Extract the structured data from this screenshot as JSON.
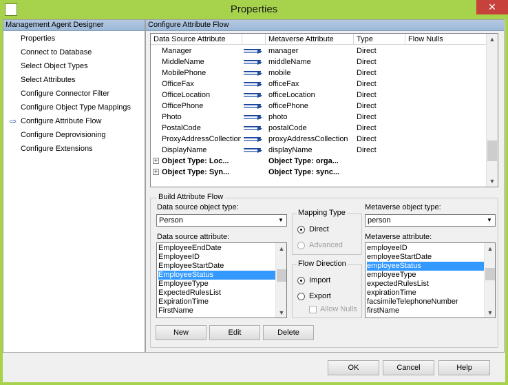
{
  "window": {
    "title": "Properties",
    "close_glyph": "✕"
  },
  "left_pane": {
    "header": "Management Agent Designer",
    "items": [
      {
        "label": "Properties"
      },
      {
        "label": "Connect to Database"
      },
      {
        "label": "Select Object Types"
      },
      {
        "label": "Select Attributes"
      },
      {
        "label": "Configure Connector Filter"
      },
      {
        "label": "Configure Object Type Mappings"
      },
      {
        "label": "Configure Attribute Flow"
      },
      {
        "label": "Configure Deprovisioning"
      },
      {
        "label": "Configure Extensions"
      }
    ],
    "current_index": 6
  },
  "right_pane": {
    "header": "Configure Attribute Flow"
  },
  "flow_grid": {
    "columns": [
      "Data Source Attribute",
      "",
      "Metaverse Attribute",
      "Type",
      "Flow Nulls"
    ],
    "rows": [
      {
        "source": "Manager",
        "metaverse": "manager",
        "type": "Direct"
      },
      {
        "source": "MiddleName",
        "metaverse": "middleName",
        "type": "Direct"
      },
      {
        "source": "MobilePhone",
        "metaverse": "mobile",
        "type": "Direct"
      },
      {
        "source": "OfficeFax",
        "metaverse": "officeFax",
        "type": "Direct"
      },
      {
        "source": "OfficeLocation",
        "metaverse": "officeLocation",
        "type": "Direct"
      },
      {
        "source": "OfficePhone",
        "metaverse": "officePhone",
        "type": "Direct"
      },
      {
        "source": "Photo",
        "metaverse": "photo",
        "type": "Direct"
      },
      {
        "source": "PostalCode",
        "metaverse": "postalCode",
        "type": "Direct"
      },
      {
        "source": "ProxyAddressCollection",
        "metaverse": "proxyAddressCollection",
        "type": "Direct"
      },
      {
        "source": "DisplayName",
        "metaverse": "displayName",
        "type": "Direct"
      }
    ],
    "groups": [
      {
        "source": "Object Type: Loc...",
        "metaverse": "Object Type: orga..."
      },
      {
        "source": "Object Type: Syn...",
        "metaverse": "Object Type: sync..."
      }
    ]
  },
  "build": {
    "label": "Build Attribute Flow",
    "ds_object_type_label": "Data source object type:",
    "ds_object_type_value": "Person",
    "ds_attribute_label": "Data source attribute:",
    "ds_attributes": [
      "EmployeeEndDate",
      "EmployeeID",
      "EmployeeStartDate",
      "EmployeeStatus",
      "EmployeeType",
      "ExpectedRulesList",
      "ExpirationTime",
      "FirstName"
    ],
    "ds_selected": 3,
    "mapping_type_label": "Mapping Type",
    "mapping_direct": "Direct",
    "mapping_advanced": "Advanced",
    "flow_direction_label": "Flow Direction",
    "flow_import": "Import",
    "flow_export": "Export",
    "allow_nulls": "Allow Nulls",
    "mv_object_type_label": "Metaverse object type:",
    "mv_object_type_value": "person",
    "mv_attribute_label": "Metaverse attribute:",
    "mv_attributes": [
      "employeeID",
      "employeeStartDate",
      "employeeStatus",
      "employeeType",
      "expectedRulesList",
      "expirationTime",
      "facsimileTelephoneNumber",
      "firstName"
    ],
    "mv_selected": 2,
    "new": "New",
    "edit": "Edit",
    "delete": "Delete"
  },
  "footer": {
    "ok": "OK",
    "cancel": "Cancel",
    "help": "Help"
  }
}
